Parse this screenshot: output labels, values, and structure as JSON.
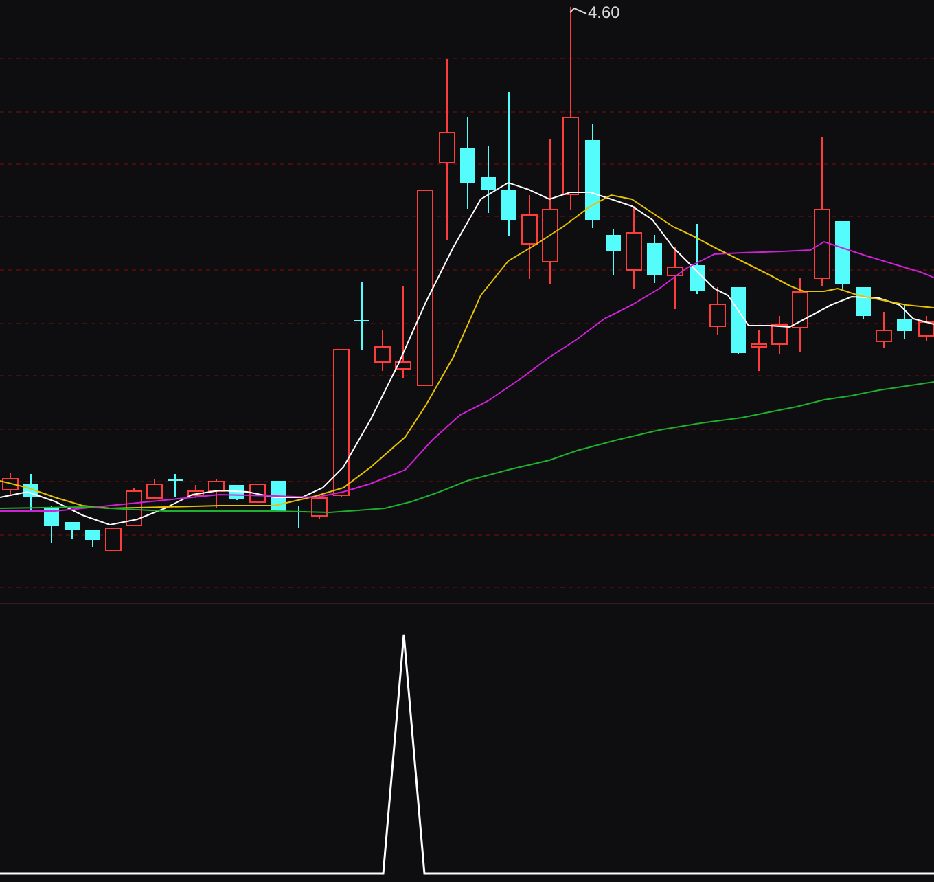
{
  "chart": {
    "high_marker": {
      "label": "4.60"
    }
  }
}
